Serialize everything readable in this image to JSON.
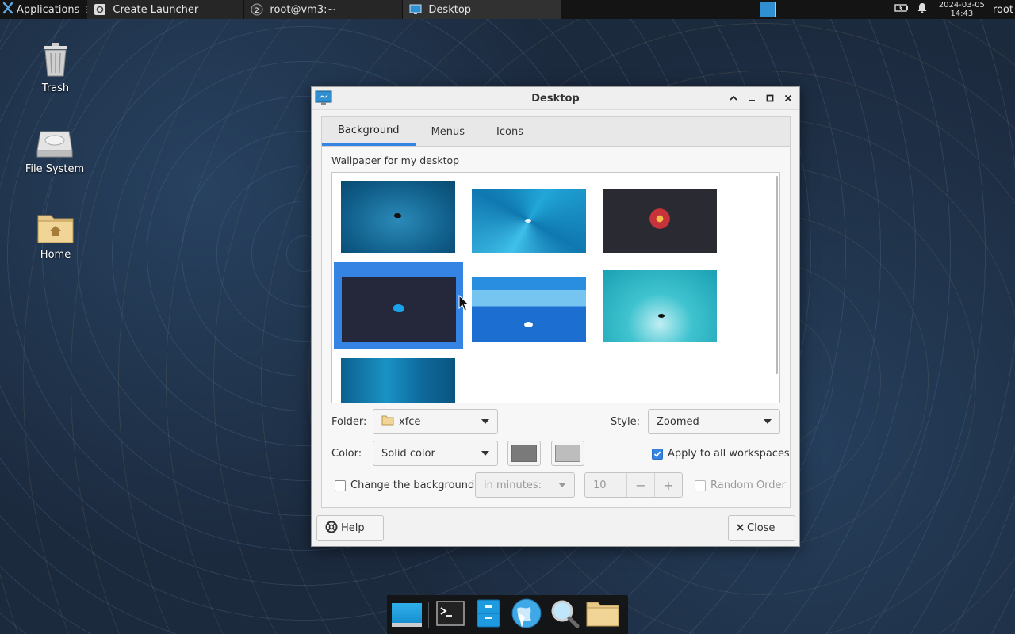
{
  "top_panel": {
    "applications_label": "Applications",
    "tasks": [
      {
        "label": "Create Launcher"
      },
      {
        "label": "root@vm3:~"
      },
      {
        "label": "Desktop"
      }
    ],
    "clock_date": "2024-03-05",
    "clock_time": "14:43",
    "user": "root"
  },
  "desktop_icons": [
    {
      "label": "Trash"
    },
    {
      "label": "File System"
    },
    {
      "label": "Home"
    }
  ],
  "window": {
    "title": "Desktop",
    "tabs": [
      "Background",
      "Menus",
      "Icons"
    ],
    "active_tab": "Background",
    "section_label": "Wallpaper for my desktop",
    "folder_label": "Folder:",
    "folder_value": "xfce",
    "style_label": "Style:",
    "style_value": "Zoomed",
    "color_label": "Color:",
    "color_value": "Solid color",
    "primary_color": "#7a7a7a",
    "secondary_color": "#bdbdbd",
    "apply_all_label": "Apply to all workspaces",
    "apply_all_checked": true,
    "change_bg_label": "Change the background",
    "change_bg_checked": false,
    "interval_unit": "in minutes:",
    "interval_value": "10",
    "random_order_label": "Random Order",
    "help_label": "Help",
    "close_label": "Close"
  },
  "accent_color": "#3584e4"
}
